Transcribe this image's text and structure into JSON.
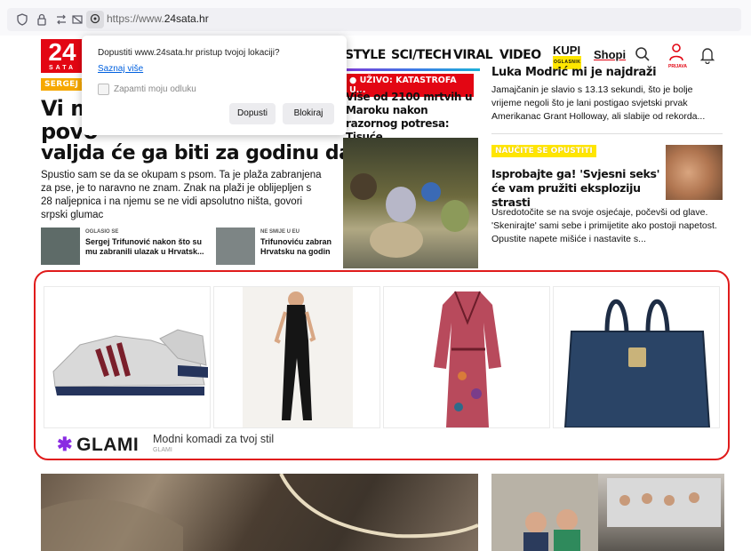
{
  "browser": {
    "url_prefix": "https://www.",
    "url_domain": "24sata.hr"
  },
  "header": {
    "logo_text": "24",
    "logo_sub": "SATA",
    "nav": [
      "STYLE",
      "SCI/TECH",
      "VIRAL",
      "VIDEO"
    ],
    "kupi": "KUPI",
    "kupi_sub": "OGLASNIK",
    "shopi": "Shopi",
    "prijava": "PRIJAVA"
  },
  "left": {
    "tag": "SERGEJ TR",
    "headline_line1": "Vi mo",
    "headline_line2": "povo",
    "headline_line3": "valjda će ga biti za godinu dana",
    "lead": "Spustio sam se da se okupam s psom. Ta je plaža zabranjena za pse, je to naravno ne znam. Znak na plaži je oblijepljen s 28 naljepnica i na njemu se ne vidi apsolutno ništa, govori srpski glumac",
    "mini": [
      {
        "label": "OGLASIO SE",
        "title": "Sergej Trifunović nakon što su mu zabranili ulazak u Hrvatsk..."
      },
      {
        "label": "NE SMIJE U EU",
        "title": "Trifunoviću zabran Hrvatsku na godin"
      }
    ]
  },
  "center": {
    "badge": "● UŽIVO: KATASTROFA U...",
    "title": "Više od 2100 mrtvih u Maroku nakon razornog potresa: Tisuće..."
  },
  "right": {
    "top_title": "Luka Modrić mi je najdraži",
    "top_text": "Jamajčanin je slavio s 13.13 sekundi, što je bolje vrijeme negoli što je lani postigao svjetski prvak Amerikanac Grant Holloway, ali slabije od rekorda...",
    "tag": "NAUČITE SE OPUSTITI",
    "title2": "Isprobajte ga! 'Svjesni seks' će vam pružiti eksploziju strasti",
    "text2": "Usredotočite se na svoje osjećaje, počevši od glave. 'Skenirajte' sami sebe i primijetite ako postoji napetost. Opustite napete mišiće i nastavite s..."
  },
  "popup": {
    "message": "Dopustiti www.24sata.hr pristup tvojoj lokaciji?",
    "learn_more": "Saznaj više",
    "remember": "Zapamti moju odluku",
    "allow": "Dopusti",
    "block": "Blokiraj"
  },
  "ad": {
    "brand": "GLAMI",
    "tagline": "Modni komadi za tvoj stil",
    "sub": "GLAMI",
    "choice": "ⓘ ✕"
  },
  "colors": {
    "brand_red": "#e30613",
    "tag_orange": "#f6a800",
    "tag_yellow": "#ffe600",
    "ad_highlight": "#e01b1b",
    "glami_purple": "#8a2be2"
  }
}
